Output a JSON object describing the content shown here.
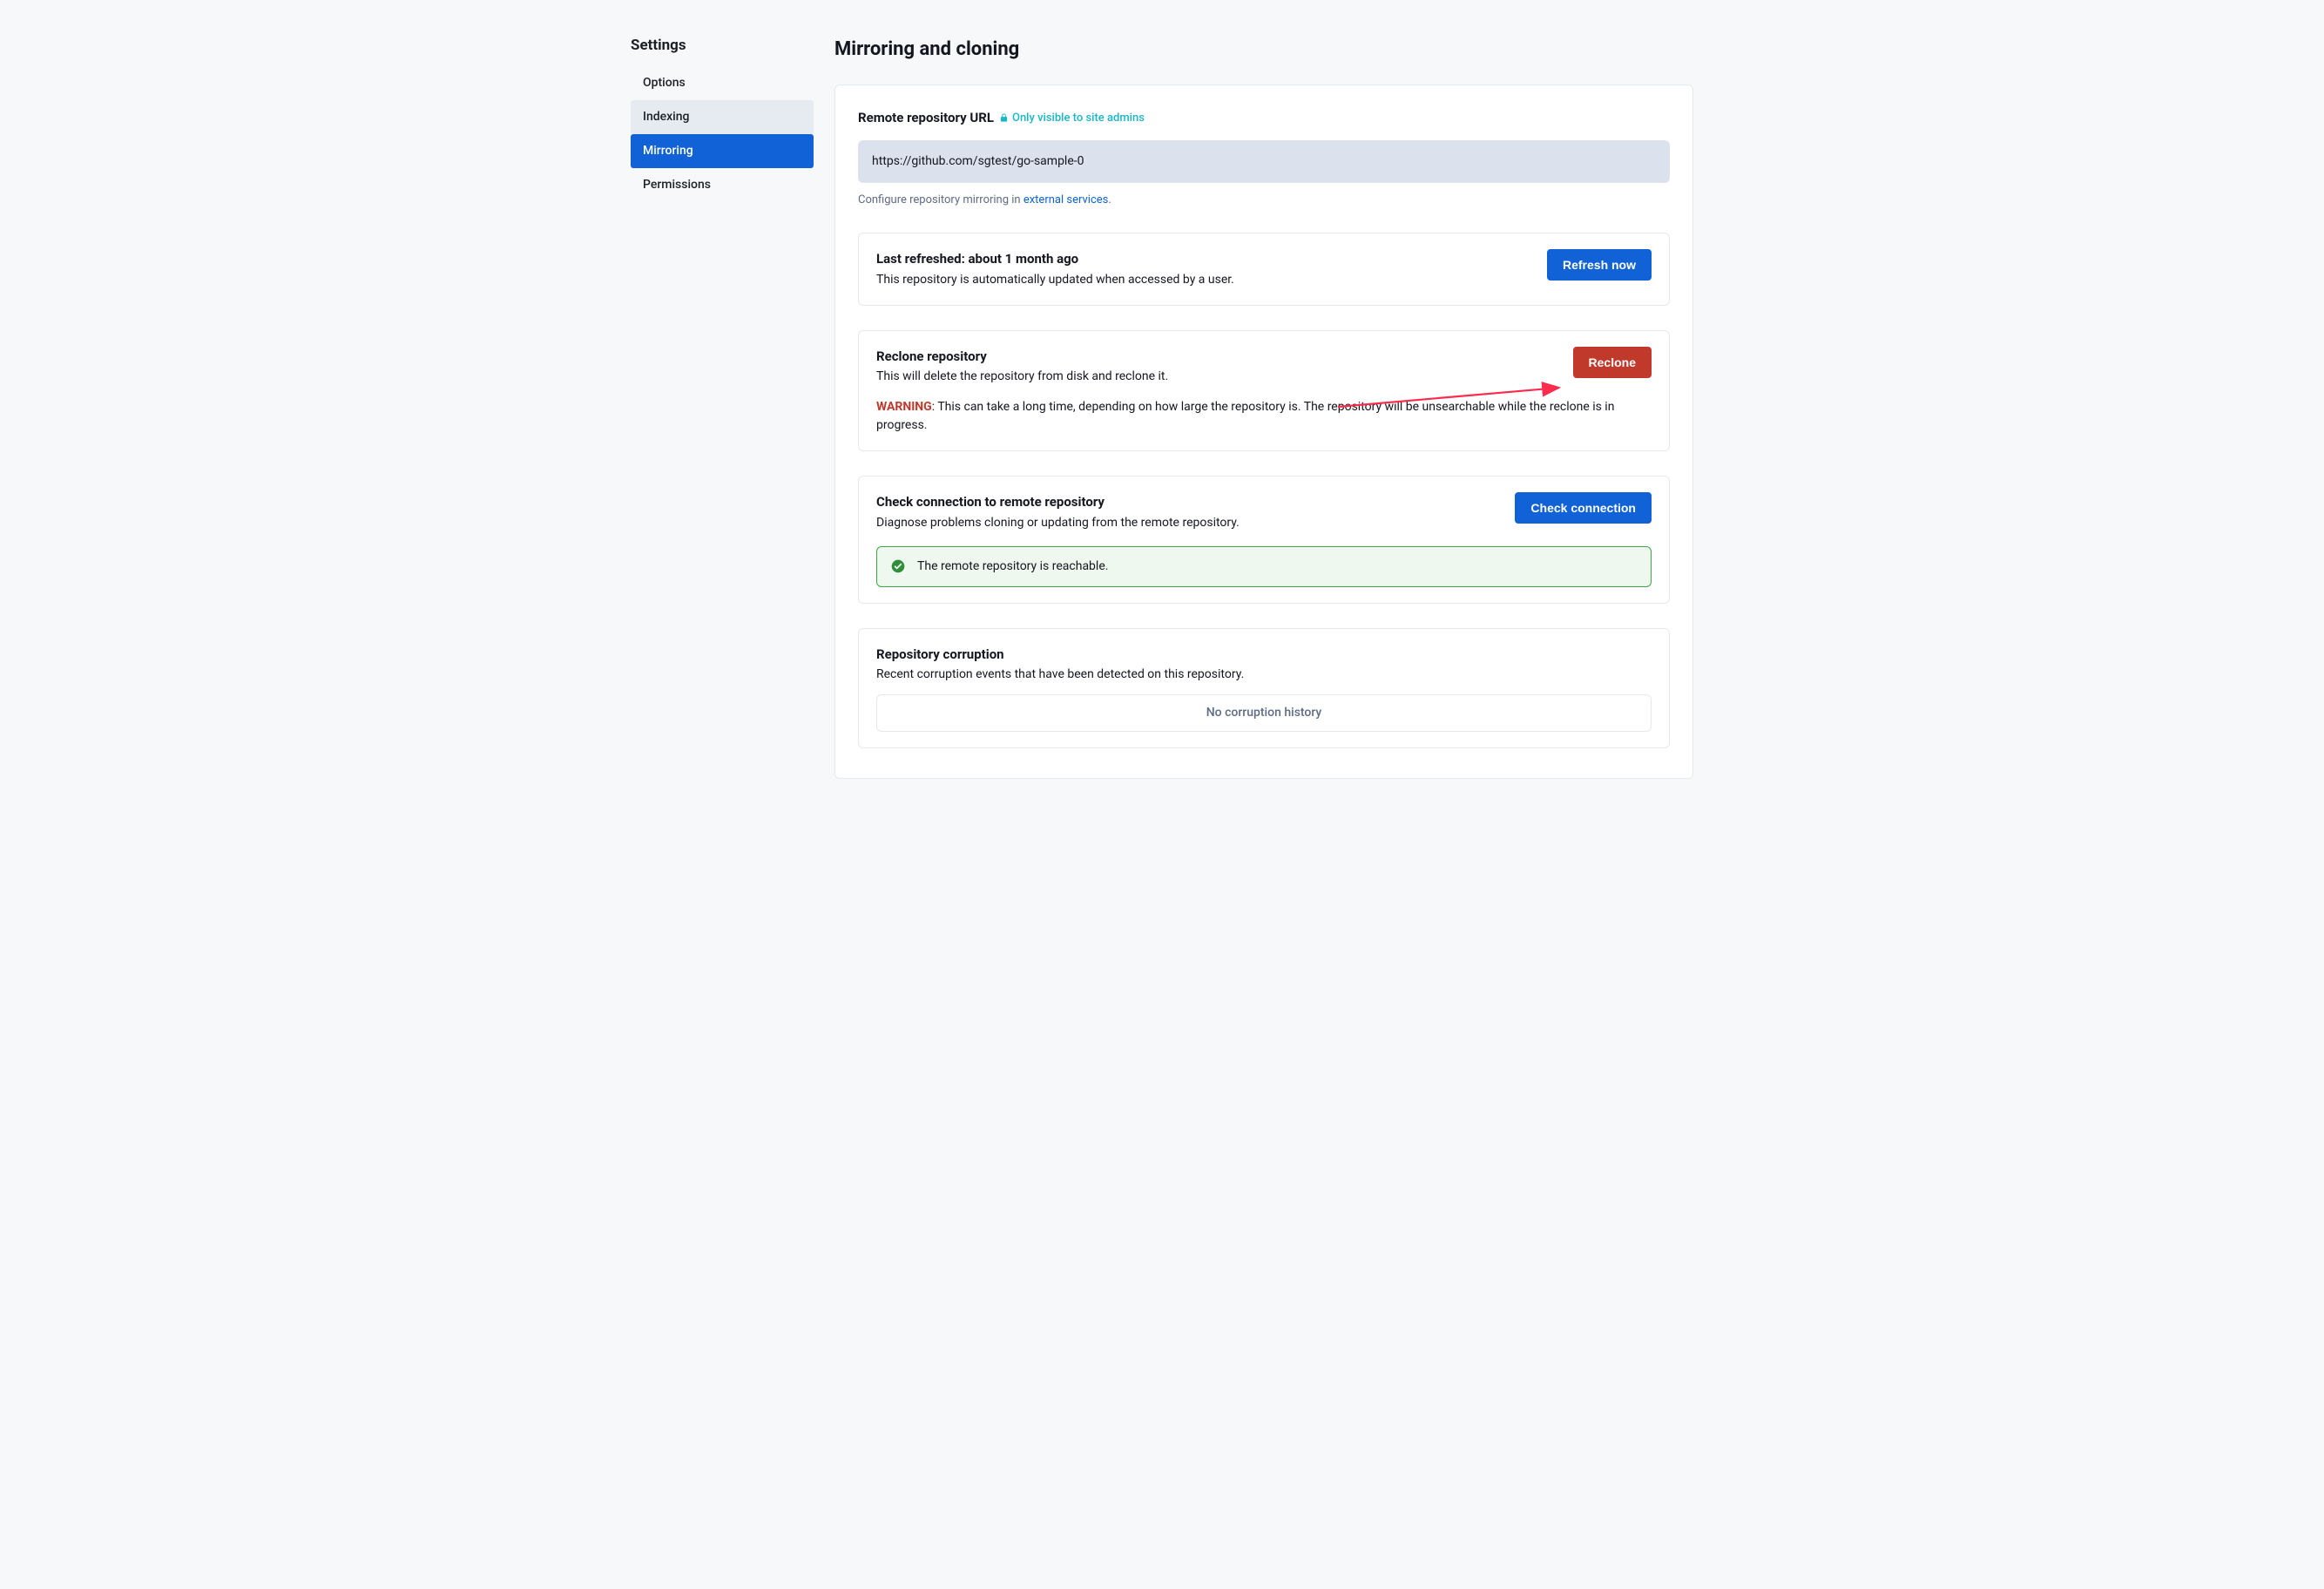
{
  "sidebar": {
    "title": "Settings",
    "items": [
      {
        "label": "Options",
        "state": "default"
      },
      {
        "label": "Indexing",
        "state": "hover"
      },
      {
        "label": "Mirroring",
        "state": "active"
      },
      {
        "label": "Permissions",
        "state": "default"
      }
    ]
  },
  "page": {
    "title": "Mirroring and cloning"
  },
  "remote": {
    "heading": "Remote repository URL",
    "badge": "Only visible to site admins",
    "url": "https://github.com/sgtest/go-sample-0",
    "hint_prefix": "Configure repository mirroring in ",
    "hint_link": "external services",
    "hint_suffix": "."
  },
  "refresh": {
    "title": "Last refreshed: about 1 month ago",
    "desc": "This repository is automatically updated when accessed by a user.",
    "button": "Refresh now"
  },
  "reclone": {
    "title": "Reclone repository",
    "desc": "This will delete the repository from disk and reclone it.",
    "button": "Reclone",
    "warning_label": "WARNING",
    "warning_text": ": This can take a long time, depending on how large the repository is. The repository will be unsearchable while the reclone is in progress."
  },
  "check": {
    "title": "Check connection to remote repository",
    "desc": "Diagnose problems cloning or updating from the remote repository.",
    "button": "Check connection",
    "alert": "The remote repository is reachable."
  },
  "corruption": {
    "title": "Repository corruption",
    "desc": "Recent corruption events that have been detected on this repository.",
    "empty": "No corruption history"
  },
  "colors": {
    "primary": "#1062d6",
    "danger": "#c0392b",
    "success_border": "#3fa648"
  }
}
